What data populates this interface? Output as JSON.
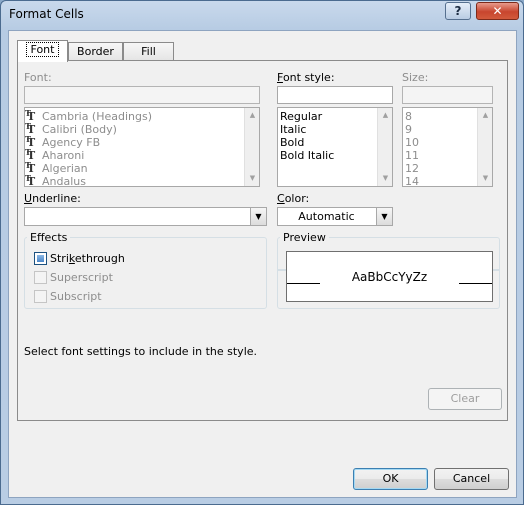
{
  "window": {
    "title": "Format Cells",
    "help_label": "?",
    "close_label": "✕"
  },
  "tabs": [
    {
      "label": "Font",
      "active": true
    },
    {
      "label": "Border",
      "active": false
    },
    {
      "label": "Fill",
      "active": false
    }
  ],
  "font": {
    "label": "Font:",
    "value": "",
    "items": [
      "Cambria (Headings)",
      "Calibri (Body)",
      "Agency FB",
      "Aharoni",
      "Algerian",
      "Andalus"
    ],
    "item_icon": "truetype-font-icon"
  },
  "font_style": {
    "label": "Font style:",
    "value": "",
    "items": [
      "Regular",
      "Italic",
      "Bold",
      "Bold Italic"
    ]
  },
  "size": {
    "label": "Size:",
    "value": "",
    "items": [
      "8",
      "9",
      "10",
      "11",
      "12",
      "14"
    ]
  },
  "underline": {
    "label": "Underline:",
    "value": ""
  },
  "color": {
    "label": "Color:",
    "value": "Automatic"
  },
  "effects": {
    "title": "Effects",
    "strikethrough": {
      "label": "Strikethrough",
      "checked": true
    },
    "superscript": {
      "label": "Superscript",
      "checked": false
    },
    "subscript": {
      "label": "Subscript",
      "checked": false
    }
  },
  "preview": {
    "title": "Preview",
    "sample": "AaBbCcYyZz"
  },
  "info_text": "Select font settings to include in the style.",
  "buttons": {
    "clear": "Clear",
    "ok": "OK",
    "cancel": "Cancel"
  }
}
